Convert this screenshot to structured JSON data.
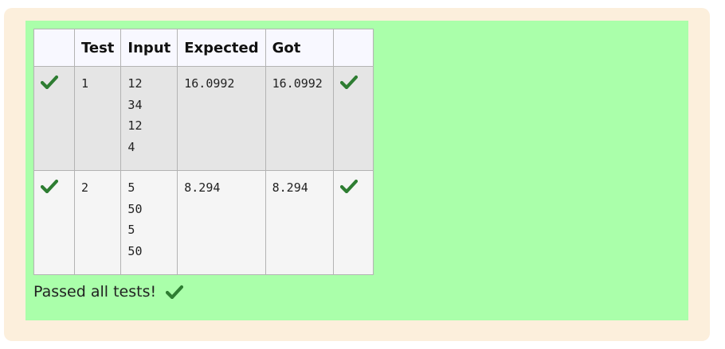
{
  "table": {
    "headers": [
      "",
      "Test",
      "Input",
      "Expected",
      "Got",
      ""
    ],
    "rows": [
      {
        "test": "1",
        "input": [
          "12",
          "34",
          "12",
          "4"
        ],
        "expected": "16.0992",
        "got": "16.0992",
        "status_icon": "check-icon"
      },
      {
        "test": "2",
        "input": [
          "5",
          "50",
          "5",
          "50"
        ],
        "expected": "8.294",
        "got": "8.294",
        "status_icon": "check-icon"
      }
    ]
  },
  "summary": {
    "text": "Passed all tests!",
    "icon": "check-icon"
  },
  "colors": {
    "outer_bg": "#fcefdc",
    "pass_bg": "#aaffaa",
    "check": "#2e7d32",
    "row1_bg": "#e5e5e5",
    "row2_bg": "#f5f5f5"
  }
}
